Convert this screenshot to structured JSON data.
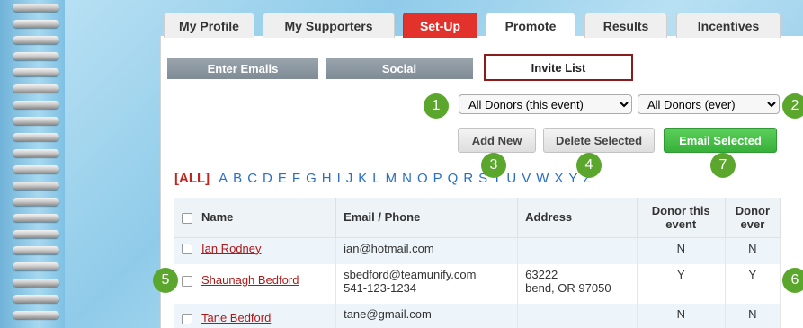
{
  "top_tabs": [
    {
      "label": "My Profile"
    },
    {
      "label": "My Supporters"
    },
    {
      "label": "Set-Up"
    },
    {
      "label": "Promote"
    },
    {
      "label": "Results"
    },
    {
      "label": "Incentives"
    }
  ],
  "sub_tabs": [
    {
      "label": "Enter Emails"
    },
    {
      "label": "Social"
    },
    {
      "label": "Invite List"
    }
  ],
  "filters": {
    "event_filter": "All Donors (this event)",
    "ever_filter": "All Donors (ever)"
  },
  "buttons": {
    "add_new": "Add New",
    "delete_selected": "Delete Selected",
    "email_selected": "Email Selected"
  },
  "alphabet": {
    "all": "[ALL]",
    "letters": [
      "A",
      "B",
      "C",
      "D",
      "E",
      "F",
      "G",
      "H",
      "I",
      "J",
      "K",
      "L",
      "M",
      "N",
      "O",
      "P",
      "Q",
      "R",
      "S",
      "T",
      "U",
      "V",
      "W",
      "X",
      "Y",
      "Z"
    ]
  },
  "table": {
    "headers": [
      "Name",
      "Email / Phone",
      "Address",
      "Donor this event",
      "Donor ever"
    ],
    "rows": [
      {
        "name": "Ian Rodney",
        "email": "ian@hotmail.com",
        "phone": "",
        "address1": "",
        "address2": "",
        "donor_event": "N",
        "donor_ever": "N"
      },
      {
        "name": "Shaunagh Bedford",
        "email": "sbedford@teamunify.com",
        "phone": "541-123-1234",
        "address1": "63222",
        "address2": "bend, OR 97050",
        "donor_event": "Y",
        "donor_ever": "Y"
      },
      {
        "name": "Tane Bedford",
        "email": "tane@gmail.com",
        "phone": "",
        "address1": "",
        "address2": "",
        "donor_event": "N",
        "donor_ever": "N"
      }
    ]
  },
  "badges": [
    "1",
    "2",
    "3",
    "4",
    "5",
    "6",
    "7"
  ],
  "colors": {
    "setup_tab": "#e3322b",
    "email_button": "#3fb940",
    "badge": "#5ba62c",
    "link": "#b01818",
    "alphabet": "#2a6fc2"
  }
}
